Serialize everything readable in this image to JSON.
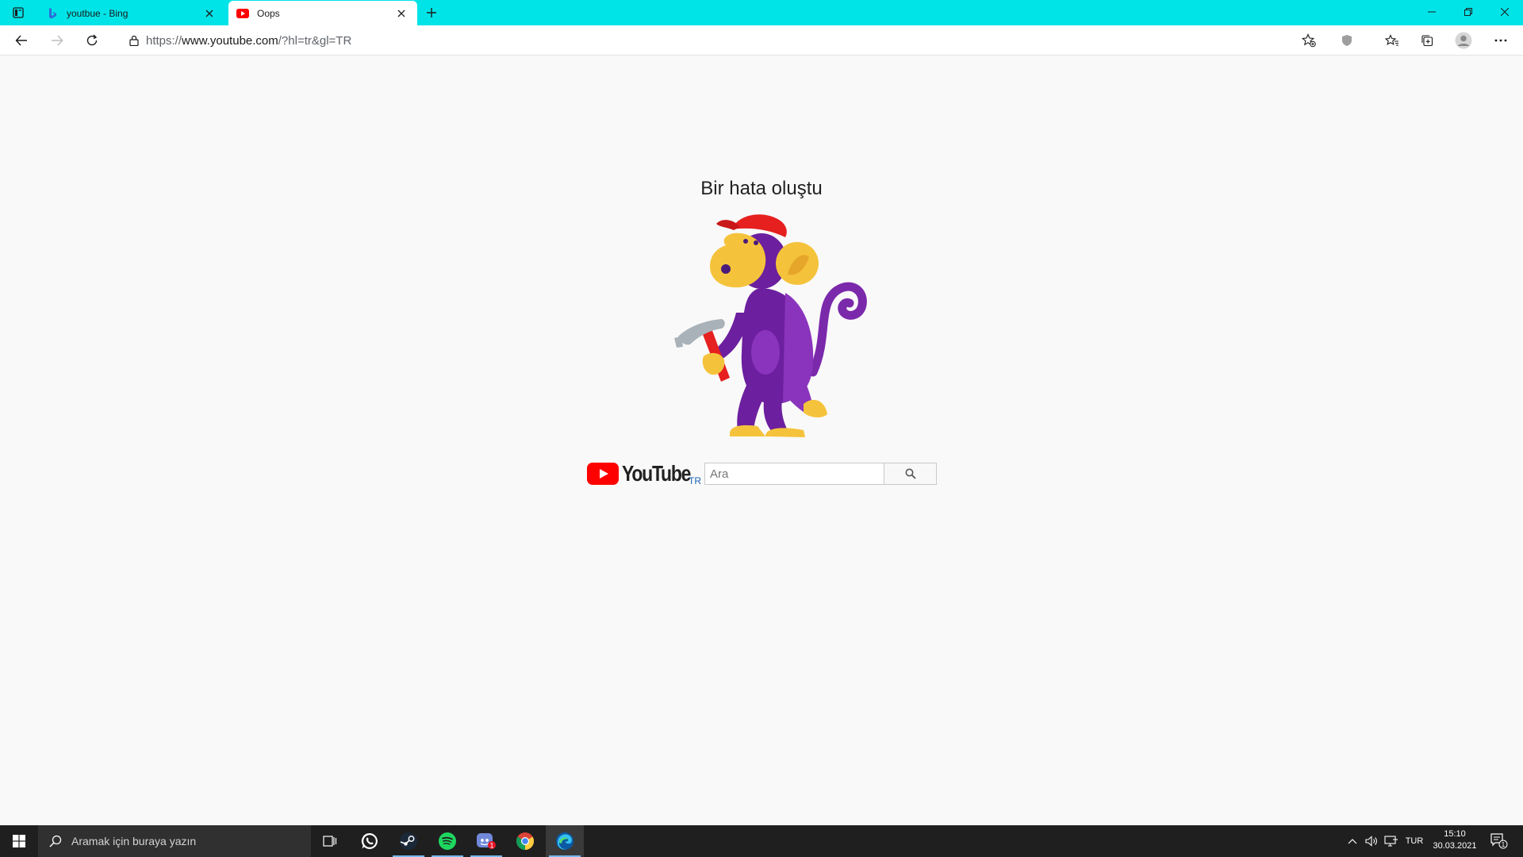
{
  "browser": {
    "tabs": [
      {
        "title": "youtbue - Bing",
        "active": false
      },
      {
        "title": "Oops",
        "active": true
      }
    ],
    "address": {
      "scheme": "https://",
      "host": "www.youtube.com",
      "path": "/?hl=tr&gl=TR"
    }
  },
  "page": {
    "error_title": "Bir hata oluştu",
    "logo_text": "YouTube",
    "country_code": "TR",
    "search_placeholder": "Ara"
  },
  "taskbar": {
    "search_placeholder": "Aramak için buraya yazın",
    "apps": [
      "task-view",
      "whatsapp",
      "steam",
      "spotify",
      "discord",
      "chrome",
      "edge"
    ],
    "discord_badge": "1",
    "language": "TUR",
    "time": "15:10",
    "date": "30.03.2021",
    "notification_count": "1"
  },
  "colors": {
    "tabstrip": "#00e4e8",
    "youtube_red": "#ff0000",
    "monkey_purple": "#6c1f9e",
    "monkey_yellow": "#f5c33b",
    "cap_red": "#e5201f"
  }
}
